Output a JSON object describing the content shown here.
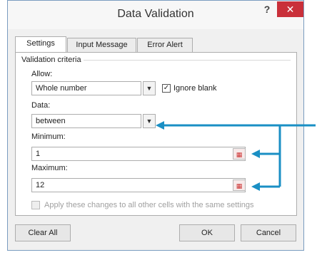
{
  "dialog": {
    "title": "Data Validation",
    "help_label": "?",
    "close_label": "✕"
  },
  "tabs": [
    {
      "label": "Settings"
    },
    {
      "label": "Input Message"
    },
    {
      "label": "Error Alert"
    }
  ],
  "settings": {
    "group_label": "Validation criteria",
    "allow_label": "Allow:",
    "allow_value": "Whole number",
    "ignore_blank_label": "Ignore blank",
    "ignore_blank_checked": true,
    "data_label": "Data:",
    "data_value": "between",
    "minimum_label": "Minimum:",
    "minimum_value": "1",
    "maximum_label": "Maximum:",
    "maximum_value": "12",
    "apply_all_label": "Apply these changes to all other cells with the same settings"
  },
  "buttons": {
    "clear_all": "Clear All",
    "ok": "OK",
    "cancel": "Cancel"
  },
  "colors": {
    "annotation_arrow": "#1a8fc4",
    "close_button": "#c9303a"
  }
}
